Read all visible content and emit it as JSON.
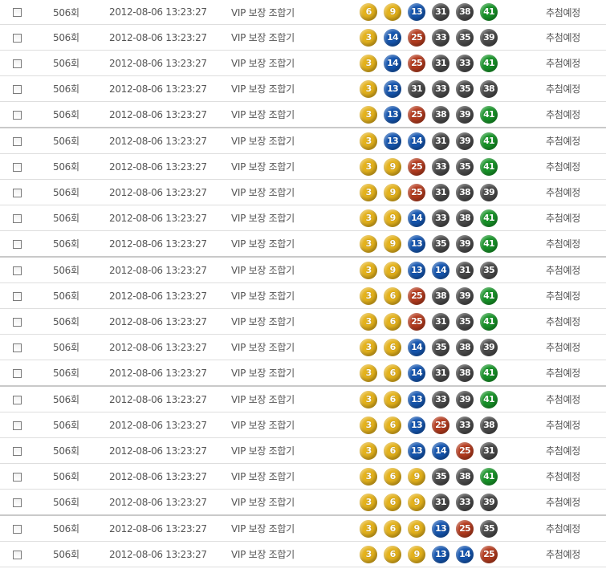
{
  "colors": {
    "y": "#e4b21c",
    "b": "#1556b0",
    "r": "#b53b1e",
    "k": "#4a4a4a",
    "g": "#179428"
  },
  "rows": [
    {
      "round": "506회",
      "date": "2012-08-06 13:23:27",
      "type": "VIP 보장 조합기",
      "numbers": [
        6,
        9,
        13,
        31,
        38,
        41
      ],
      "status": "추첨예정"
    },
    {
      "round": "506회",
      "date": "2012-08-06 13:23:27",
      "type": "VIP 보장 조합기",
      "numbers": [
        3,
        14,
        25,
        33,
        35,
        39
      ],
      "status": "추첨예정"
    },
    {
      "round": "506회",
      "date": "2012-08-06 13:23:27",
      "type": "VIP 보장 조합기",
      "numbers": [
        3,
        14,
        25,
        31,
        33,
        41
      ],
      "status": "추첨예정"
    },
    {
      "round": "506회",
      "date": "2012-08-06 13:23:27",
      "type": "VIP 보장 조합기",
      "numbers": [
        3,
        13,
        31,
        33,
        35,
        38
      ],
      "status": "추첨예정"
    },
    {
      "round": "506회",
      "date": "2012-08-06 13:23:27",
      "type": "VIP 보장 조합기",
      "numbers": [
        3,
        13,
        25,
        38,
        39,
        41
      ],
      "status": "추첨예정"
    },
    {
      "round": "506회",
      "date": "2012-08-06 13:23:27",
      "type": "VIP 보장 조합기",
      "numbers": [
        3,
        13,
        14,
        31,
        39,
        41
      ],
      "status": "추첨예정"
    },
    {
      "round": "506회",
      "date": "2012-08-06 13:23:27",
      "type": "VIP 보장 조합기",
      "numbers": [
        3,
        9,
        25,
        33,
        35,
        41
      ],
      "status": "추첨예정"
    },
    {
      "round": "506회",
      "date": "2012-08-06 13:23:27",
      "type": "VIP 보장 조합기",
      "numbers": [
        3,
        9,
        25,
        31,
        38,
        39
      ],
      "status": "추첨예정"
    },
    {
      "round": "506회",
      "date": "2012-08-06 13:23:27",
      "type": "VIP 보장 조합기",
      "numbers": [
        3,
        9,
        14,
        33,
        38,
        41
      ],
      "status": "추첨예정"
    },
    {
      "round": "506회",
      "date": "2012-08-06 13:23:27",
      "type": "VIP 보장 조합기",
      "numbers": [
        3,
        9,
        13,
        35,
        39,
        41
      ],
      "status": "추첨예정"
    },
    {
      "round": "506회",
      "date": "2012-08-06 13:23:27",
      "type": "VIP 보장 조합기",
      "numbers": [
        3,
        9,
        13,
        14,
        31,
        35
      ],
      "status": "추첨예정"
    },
    {
      "round": "506회",
      "date": "2012-08-06 13:23:27",
      "type": "VIP 보장 조합기",
      "numbers": [
        3,
        6,
        25,
        38,
        39,
        41
      ],
      "status": "추첨예정"
    },
    {
      "round": "506회",
      "date": "2012-08-06 13:23:27",
      "type": "VIP 보장 조합기",
      "numbers": [
        3,
        6,
        25,
        31,
        35,
        41
      ],
      "status": "추첨예정"
    },
    {
      "round": "506회",
      "date": "2012-08-06 13:23:27",
      "type": "VIP 보장 조합기",
      "numbers": [
        3,
        6,
        14,
        35,
        38,
        39
      ],
      "status": "추첨예정"
    },
    {
      "round": "506회",
      "date": "2012-08-06 13:23:27",
      "type": "VIP 보장 조합기",
      "numbers": [
        3,
        6,
        14,
        31,
        38,
        41
      ],
      "status": "추첨예정"
    },
    {
      "round": "506회",
      "date": "2012-08-06 13:23:27",
      "type": "VIP 보장 조합기",
      "numbers": [
        3,
        6,
        13,
        33,
        39,
        41
      ],
      "status": "추첨예정"
    },
    {
      "round": "506회",
      "date": "2012-08-06 13:23:27",
      "type": "VIP 보장 조합기",
      "numbers": [
        3,
        6,
        13,
        25,
        33,
        38
      ],
      "status": "추첨예정"
    },
    {
      "round": "506회",
      "date": "2012-08-06 13:23:27",
      "type": "VIP 보장 조합기",
      "numbers": [
        3,
        6,
        13,
        14,
        25,
        31
      ],
      "status": "추첨예정"
    },
    {
      "round": "506회",
      "date": "2012-08-06 13:23:27",
      "type": "VIP 보장 조합기",
      "numbers": [
        3,
        6,
        9,
        35,
        38,
        41
      ],
      "status": "추첨예정"
    },
    {
      "round": "506회",
      "date": "2012-08-06 13:23:27",
      "type": "VIP 보장 조합기",
      "numbers": [
        3,
        6,
        9,
        31,
        33,
        39
      ],
      "status": "추첨예정"
    },
    {
      "round": "506회",
      "date": "2012-08-06 13:23:27",
      "type": "VIP 보장 조합기",
      "numbers": [
        3,
        6,
        9,
        13,
        25,
        35
      ],
      "status": "추첨예정"
    },
    {
      "round": "506회",
      "date": "2012-08-06 13:23:27",
      "type": "VIP 보장 조합기",
      "numbers": [
        3,
        6,
        9,
        13,
        14,
        25
      ],
      "status": "추첨예정"
    }
  ]
}
